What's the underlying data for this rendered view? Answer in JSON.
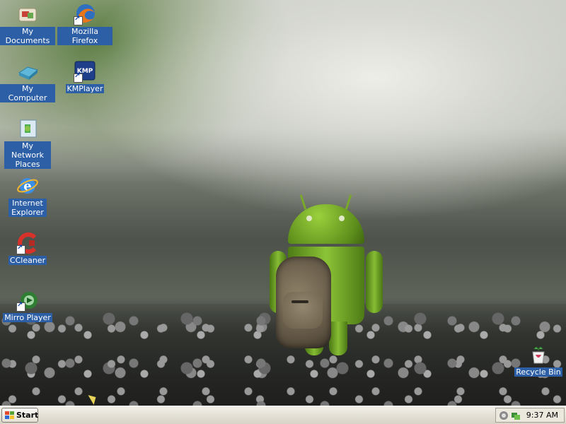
{
  "desktop": {
    "icons": [
      {
        "label": "My Documents"
      },
      {
        "label": "Mozilla Firefox"
      },
      {
        "label": "My Computer"
      },
      {
        "label": "KMPlayer"
      },
      {
        "label": "My Network Places"
      },
      {
        "label": "Internet Explorer"
      },
      {
        "label": "CCleaner"
      },
      {
        "label": "Mirro Player"
      },
      {
        "label": "Recycle Bin"
      }
    ],
    "kmp_badge": "KMP"
  },
  "taskbar": {
    "start_label": "Start",
    "clock": "9:37 AM",
    "tray_icons": [
      "speaker-icon",
      "network-icon"
    ]
  },
  "colors": {
    "label_highlight": "#2d5fa6",
    "taskbar": "#e4e1d6"
  }
}
